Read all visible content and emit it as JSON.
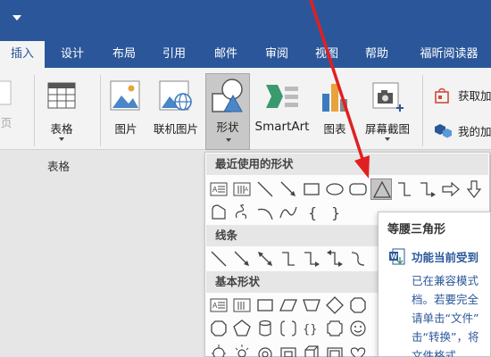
{
  "tabs": [
    "插入",
    "设计",
    "布局",
    "引用",
    "邮件",
    "审阅",
    "视图",
    "帮助",
    "福昕阅读器"
  ],
  "ribbon": {
    "left_partial_label": "页",
    "table_label": "表格",
    "table_group": "表格",
    "picture_label": "图片",
    "online_picture_label": "联机图片",
    "shapes_label": "形状",
    "smartart_label": "SmartArt",
    "chart_label": "图表",
    "screenshot_label": "屏幕截图",
    "get_addins_label": "获取加",
    "my_addins_label": "我的加"
  },
  "gallery": {
    "recent_header": "最近使用的形状",
    "lines_header": "线条",
    "basic_header": "基本形状"
  },
  "tooltip": {
    "title": "等腰三角形",
    "heading": "功能当前受到",
    "body_lines": [
      "已在兼容模式",
      "档。若要完全",
      "请单击“文件”",
      "击“转换”，将",
      "文件格式。"
    ]
  },
  "colors": {
    "accent": "#2b579a",
    "arrow": "#e02020"
  }
}
